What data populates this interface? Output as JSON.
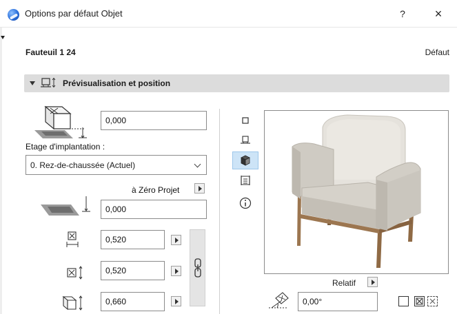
{
  "window": {
    "title": "Options par défaut Objet",
    "help_label": "?",
    "close_label": "×"
  },
  "header": {
    "object_name": "Fauteuil 1 24",
    "default_label": "Défaut"
  },
  "section": {
    "title": "Prévisualisation et position"
  },
  "fields": {
    "elevation_value": "0,000",
    "story_label": "Etage d'implantation :",
    "story_selected": "0. Rez-de-chaussée (Actuel)",
    "zero_projet_label": "à Zéro Projet",
    "zero_projet_value": "0,000",
    "width_value": "0,520",
    "depth_value": "0,520",
    "height_value": "0,660",
    "relatif_label": "Relatif",
    "angle_value": "0,00°"
  },
  "view_modes": {
    "items": [
      "floor-plan",
      "section",
      "3d",
      "list",
      "info"
    ],
    "active": "3d"
  },
  "colors": {
    "accent_active": "#cde4f7",
    "section_bg": "#dcdcdc",
    "chair_fabric": "#d9d6cf",
    "chair_wood": "#a07a55"
  }
}
